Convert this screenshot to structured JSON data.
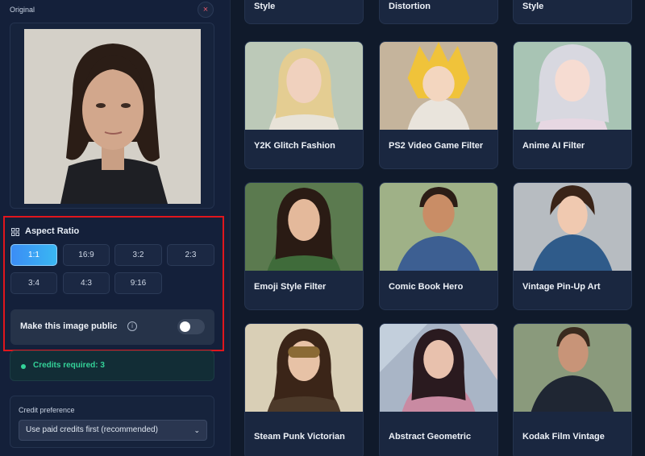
{
  "original_label": "Original",
  "close_symbol": "×",
  "aspect_ratio": {
    "label": "Aspect Ratio",
    "options": [
      "1:1",
      "16:9",
      "3:2",
      "2:3",
      "3:4",
      "4:3",
      "9:16"
    ],
    "selected": "1:1"
  },
  "public_toggle": {
    "label": "Make this image public",
    "info_symbol": "i",
    "on": false
  },
  "credits": {
    "text": "Credits required: 3",
    "color": "#34d399"
  },
  "credit_preference": {
    "label": "Credit preference",
    "selected": "Use paid credits first (recommended)",
    "chevron": "⌄"
  },
  "top_partial_cards": [
    "Style",
    "Distortion",
    "Style"
  ],
  "style_cards": [
    "Y2K Glitch Fashion",
    "PS2 Video Game Filter",
    "Anime AI Filter",
    "Emoji Style Filter",
    "Comic Book Hero",
    "Vintage Pin-Up Art",
    "Steam Punk Victorian",
    "Abstract Geometric",
    "Kodak Film Vintage"
  ],
  "colors": {
    "accent": "#3b8df5",
    "highlight_border": "#e0161d",
    "background": "#101a2b"
  }
}
